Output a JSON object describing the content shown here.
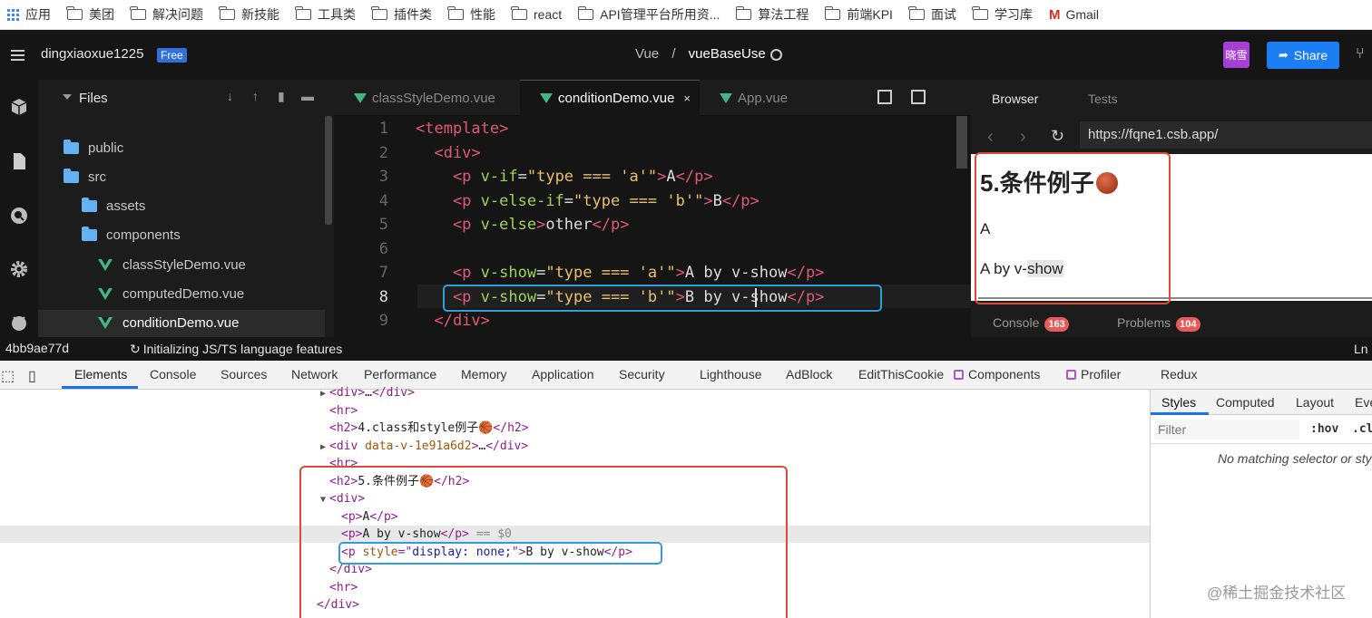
{
  "bookmarks": {
    "apps": "应用",
    "folders": [
      "美团",
      "解决问题",
      "新技能",
      "工具类",
      "插件类",
      "性能",
      "react",
      "API管理平台所用资...",
      "算法工程",
      "前端KPI",
      "面试",
      "学习库"
    ],
    "gmail": "Gmail"
  },
  "topbar": {
    "username": "dingxiaoxue1225",
    "plan": "Free",
    "breadcrumb_folder": "Vue",
    "breadcrumb_sep": "/",
    "breadcrumb_project": "vueBaseUse",
    "avatar_text": "晓雪",
    "share_label": "Share"
  },
  "files": {
    "title": "Files",
    "items": [
      {
        "name": "public",
        "type": "folder"
      },
      {
        "name": "src",
        "type": "folder-open"
      },
      {
        "name": "assets",
        "type": "folder"
      },
      {
        "name": "components",
        "type": "folder-open"
      },
      {
        "name": "classStyleDemo.vue",
        "type": "vue"
      },
      {
        "name": "computedDemo.vue",
        "type": "vue"
      },
      {
        "name": "conditionDemo.vue",
        "type": "vue",
        "selected": true
      }
    ]
  },
  "editor": {
    "tabs": [
      {
        "label": "classStyleDemo.vue",
        "active": false
      },
      {
        "label": "conditionDemo.vue",
        "active": true,
        "close": "×"
      },
      {
        "label": "App.vue",
        "active": false
      }
    ],
    "more": "•••",
    "lines": [
      {
        "n": "1",
        "parts": [
          [
            "tg",
            "<template>"
          ]
        ]
      },
      {
        "n": "2",
        "parts": [
          [
            "tg",
            "  <div>"
          ]
        ]
      },
      {
        "n": "3",
        "parts": [
          [
            "tg",
            "    <p "
          ],
          [
            "at",
            "v-if"
          ],
          [
            "tx",
            "="
          ],
          [
            "st",
            "\"type === 'a'\""
          ],
          [
            "tg",
            ">"
          ],
          [
            "tx",
            "A"
          ],
          [
            "tg",
            "</p>"
          ]
        ]
      },
      {
        "n": "4",
        "parts": [
          [
            "tg",
            "    <p "
          ],
          [
            "at",
            "v-else-if"
          ],
          [
            "tx",
            "="
          ],
          [
            "st",
            "\"type === 'b'\""
          ],
          [
            "tg",
            ">"
          ],
          [
            "tx",
            "B"
          ],
          [
            "tg",
            "</p>"
          ]
        ]
      },
      {
        "n": "5",
        "parts": [
          [
            "tg",
            "    <p "
          ],
          [
            "at",
            "v-else"
          ],
          [
            "tg",
            ">"
          ],
          [
            "tx",
            "other"
          ],
          [
            "tg",
            "</p>"
          ]
        ]
      },
      {
        "n": "6",
        "parts": []
      },
      {
        "n": "7",
        "parts": [
          [
            "tg",
            "    <p "
          ],
          [
            "at",
            "v-show"
          ],
          [
            "tx",
            "="
          ],
          [
            "st",
            "\"type === 'a'\""
          ],
          [
            "tg",
            ">"
          ],
          [
            "tx",
            "A by v-show"
          ],
          [
            "tg",
            "</p>"
          ]
        ]
      },
      {
        "n": "8",
        "parts": [
          [
            "tg",
            "    <p "
          ],
          [
            "at",
            "v-show"
          ],
          [
            "tx",
            "="
          ],
          [
            "st",
            "\"type === 'b'\""
          ],
          [
            "tg",
            ">"
          ],
          [
            "tx",
            "B by v-show"
          ],
          [
            "tg",
            "</p>"
          ]
        ],
        "current": true
      },
      {
        "n": "9",
        "parts": [
          [
            "tg",
            "  </div>"
          ]
        ]
      }
    ]
  },
  "browser": {
    "tab_browser": "Browser",
    "tab_tests": "Tests",
    "url": "https://fqne1.csb.app/",
    "heading": "5.条件例子",
    "p1": "A",
    "p2_prefix": "A by v-",
    "p2_highlight": "show",
    "console_label": "Console",
    "console_count": "163",
    "problems_label": "Problems",
    "problems_count": "104"
  },
  "status": {
    "hash": "4bb9ae77d",
    "message": "Initializing JS/TS language features",
    "right": "Ln"
  },
  "devtools": {
    "tabs": [
      "Elements",
      "Console",
      "Sources",
      "Network",
      "Performance",
      "Memory",
      "Application",
      "Security",
      "Lighthouse",
      "AdBlock",
      "EditThisCookie",
      "Components",
      "Profiler",
      "Redux"
    ],
    "rows": [
      {
        "arrow": "▶",
        "parts": [
          [
            "et",
            "<div>"
          ],
          [
            "ex",
            "…"
          ],
          [
            "et",
            "</div>"
          ]
        ]
      },
      {
        "arrow": "",
        "parts": [
          [
            "et",
            "<hr>"
          ]
        ]
      },
      {
        "arrow": "",
        "parts": [
          [
            "et",
            "<h2>"
          ],
          [
            "ex",
            "4.class和style例子🏀"
          ],
          [
            "et",
            "</h2>"
          ]
        ]
      },
      {
        "arrow": "▶",
        "parts": [
          [
            "et",
            "<div "
          ],
          [
            "ea",
            "data-v-1e91a6d2"
          ],
          [
            "et",
            ">"
          ],
          [
            "ex",
            "…"
          ],
          [
            "et",
            "</div>"
          ]
        ]
      },
      {
        "arrow": "",
        "parts": [
          [
            "et",
            "<hr>"
          ]
        ]
      },
      {
        "arrow": "",
        "parts": [
          [
            "et",
            "<h2>"
          ],
          [
            "ex",
            "5.条件例子🏀"
          ],
          [
            "et",
            "</h2>"
          ]
        ]
      },
      {
        "arrow": "▼",
        "parts": [
          [
            "et",
            "<div>"
          ]
        ]
      },
      {
        "arrow": "",
        "parts": [
          [
            "et",
            "<p>"
          ],
          [
            "ex",
            "A"
          ],
          [
            "et",
            "</p>"
          ]
        ]
      },
      {
        "arrow": "",
        "parts": [
          [
            "et",
            "<p>"
          ],
          [
            "ex",
            "A by v-show"
          ],
          [
            "et",
            "</p>"
          ],
          [
            "gray",
            " == $0"
          ]
        ]
      },
      {
        "arrow": "",
        "parts": [
          [
            "et",
            "<p "
          ],
          [
            "ea",
            "style"
          ],
          [
            "et",
            "=\""
          ],
          [
            "ev",
            "display: none;"
          ],
          [
            "et",
            "\">"
          ],
          [
            "ex",
            "B by v-show"
          ],
          [
            "et",
            "</p>"
          ]
        ]
      },
      {
        "arrow": "",
        "parts": [
          [
            "et",
            "</div>"
          ]
        ]
      },
      {
        "arrow": "",
        "parts": [
          [
            "et",
            "<hr>"
          ]
        ]
      },
      {
        "arrow": "",
        "parts": [
          [
            "et",
            "</div>"
          ]
        ]
      }
    ],
    "styles_tabs": [
      "Styles",
      "Computed",
      "Layout",
      "Eve"
    ],
    "filter_placeholder": "Filter",
    "hov": ":hov",
    "cls": ".cl",
    "no_match": "No matching selector or sty"
  },
  "watermark": "@稀土掘金技术社区"
}
